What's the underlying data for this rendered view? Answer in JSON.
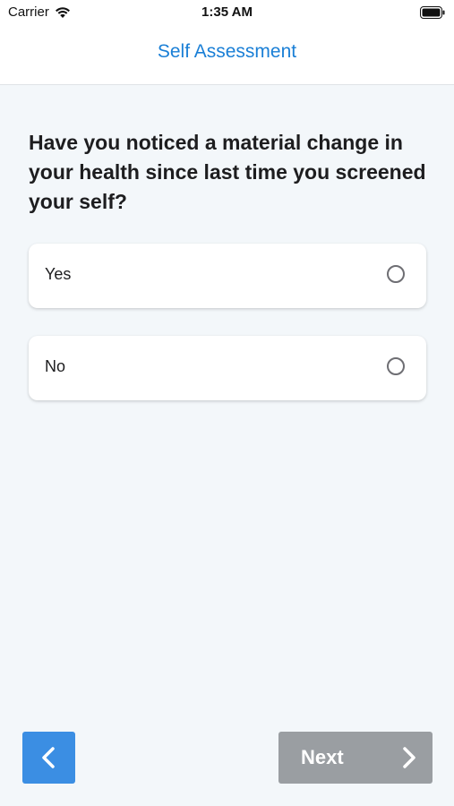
{
  "status_bar": {
    "carrier": "Carrier",
    "time": "1:35 AM",
    "icons": [
      "wifi-icon",
      "battery-icon"
    ]
  },
  "nav": {
    "title": "Self Assessment",
    "title_color": "#1a7fd6"
  },
  "question": {
    "text": "Have you noticed a material change in your health since last time you screened your self?"
  },
  "options": [
    {
      "label": "Yes",
      "selected": false
    },
    {
      "label": "No",
      "selected": false
    }
  ],
  "footer": {
    "back_icon": "chevron-left-icon",
    "back_color": "#3b8ee3",
    "next_label": "Next",
    "next_icon": "chevron-right-icon",
    "next_color": "#9a9ea2"
  }
}
